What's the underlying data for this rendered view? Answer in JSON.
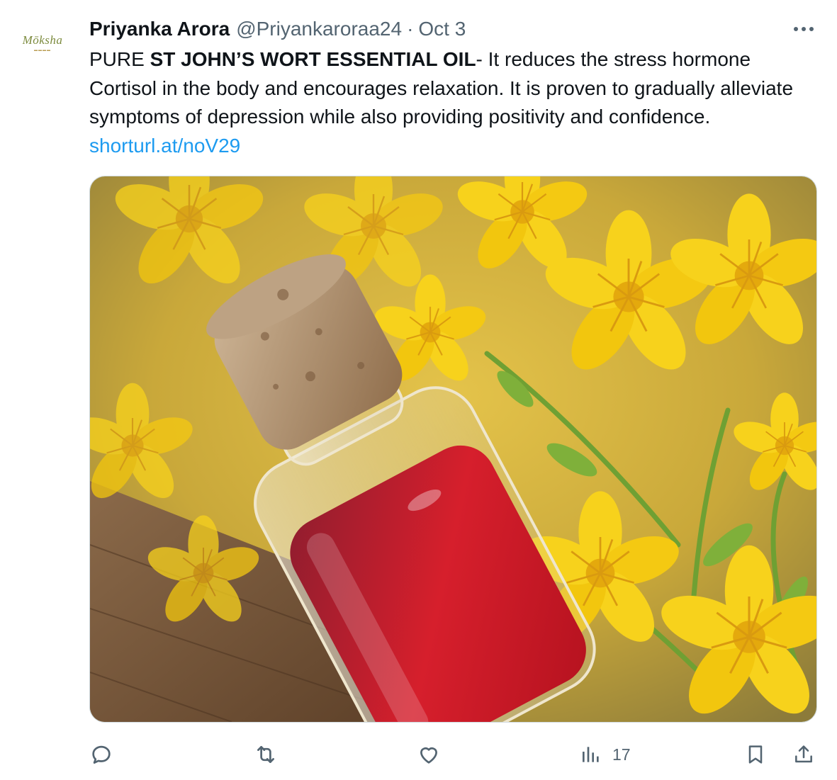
{
  "tweet": {
    "author": {
      "name": "Priyanka Arora",
      "handle": "@Priyankaroraa24",
      "avatar_logo": "Mōksha"
    },
    "separator": "·",
    "date": "Oct 3",
    "text": {
      "prefix": "PURE ",
      "bold": "ST JOHN’S WORT ESSENTIAL OIL",
      "body": "- It reduces the stress hormone Cortisol in the body and encourages relaxation. It is proven to gradually alleviate symptoms of depression while also providing positivity and confidence. ",
      "link": "shorturl.at/noV29"
    },
    "media": {
      "description_icon": "photo-st-johns-wort-oil-bottle"
    },
    "actions": {
      "reply_icon": "reply-icon",
      "retweet_icon": "retweet-icon",
      "like_icon": "like-icon",
      "views_icon": "views-icon",
      "views_count": "17",
      "bookmark_icon": "bookmark-icon",
      "share_icon": "share-icon"
    },
    "colors": {
      "text": "#0f1419",
      "secondary": "#536471",
      "link": "#1d9bf0",
      "border": "#cfd9de"
    }
  }
}
